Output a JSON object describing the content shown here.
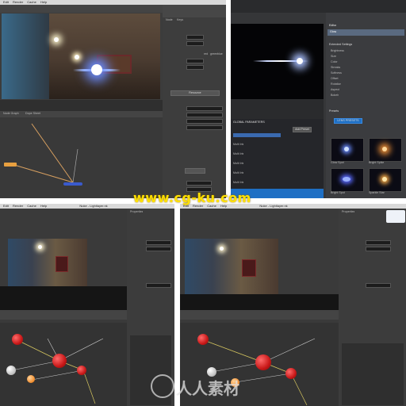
{
  "watermark": {
    "url": "www.cg-ku.com",
    "logo_text": "人人素材"
  },
  "q1": {
    "menubar": [
      "Edit",
      "Render",
      "Cache",
      "Help"
    ],
    "prop_tabs": [
      "Node",
      "Keys"
    ],
    "sections": [
      "Resource",
      "Keys"
    ],
    "channel_labels": [
      "red",
      "green",
      "blue"
    ],
    "footer_tabs": [
      "Node Graph",
      "Dope Sheet",
      "Curve Editor"
    ]
  },
  "q2": {
    "panel_title": "Editor",
    "selected_item": "Glow",
    "section": "Extended Settings",
    "param_labels": [
      "Brightness",
      "Size",
      "Color",
      "Streaks",
      "Softness",
      "Offset",
      "Rotation",
      "Aspect",
      "Bokeh"
    ],
    "global_params": "GLOBAL PARAMETERS",
    "add_preset": "Add Preset",
    "list_label": "Multi Iris",
    "presets_header": "Presets",
    "lens_presets_btn": "LENS PRESETS",
    "preset_names": [
      "Glow Spot",
      "Bright Spike",
      "Bright Spot",
      "Sparkle Star"
    ]
  },
  "q3": {
    "menubar": [
      "Edit",
      "Render",
      "Cache",
      "Help"
    ],
    "title": "Nuke - Lightlayer.nk",
    "panel_title": "Properties"
  },
  "q4": {
    "menubar": [
      "Edit",
      "Render",
      "Cache",
      "Help"
    ],
    "title": "Nuke - Lightlayer.nk",
    "panel_title": "Properties"
  }
}
